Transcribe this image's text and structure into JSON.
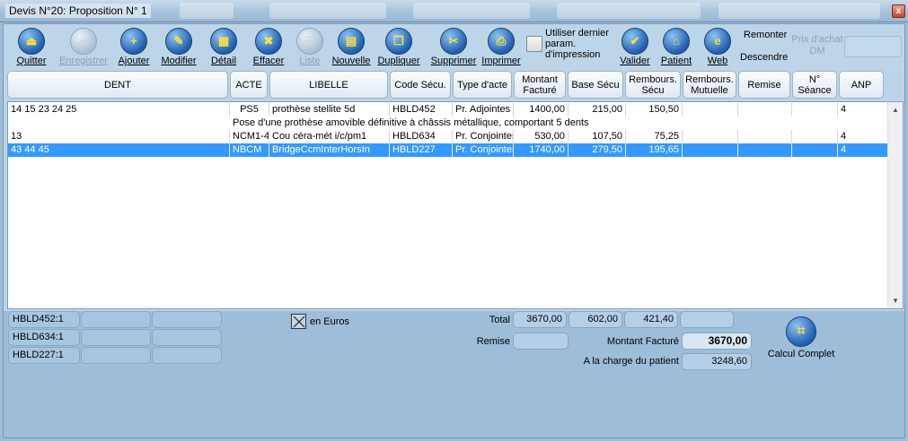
{
  "window": {
    "title": "Devis N°20: Proposition N° 1",
    "close": "x"
  },
  "toolbar": {
    "buttons": [
      {
        "label": "Quitter",
        "glyph": "⏏"
      },
      {
        "label": "Enregistrer",
        "glyph": "●"
      },
      {
        "label": "Ajouter",
        "glyph": "+"
      },
      {
        "label": "Modifier",
        "glyph": "✎"
      },
      {
        "label": "Détail",
        "glyph": "▦"
      },
      {
        "label": "Effacer",
        "glyph": "✖"
      },
      {
        "label": "Liste",
        "glyph": "☰"
      },
      {
        "label": "Nouvelle",
        "glyph": "▤"
      },
      {
        "label": "Dupliquer",
        "glyph": "❐"
      },
      {
        "label": "Supprimer",
        "glyph": "✂"
      },
      {
        "label": "Imprimer",
        "glyph": "⎙"
      }
    ],
    "use_last_params_label": "Utiliser dernier param. d'impression",
    "right_buttons": [
      {
        "label": "Valider",
        "glyph": "✔"
      },
      {
        "label": "Patient",
        "glyph": "⌂"
      },
      {
        "label": "Web",
        "glyph": "e"
      }
    ],
    "move_up": "Remonter",
    "move_down": "Descendre",
    "purchase_price_label": "Prix d'achat DM",
    "purchase_price_value": ""
  },
  "columns": [
    "DENT",
    "ACTE",
    "LIBELLE",
    "Code Sécu.",
    "Type d'acte",
    "Montant Facturé",
    "Base Sécu",
    "Rembours. Sécu",
    "Rembours. Mutuelle",
    "Remise",
    "N° Séance",
    "ANP"
  ],
  "rows": [
    {
      "dent": "14 15 23 24 25",
      "acte": "PS5",
      "libelle": "prothèse stellite 5d",
      "code": "HBLD452",
      "type": "Pr. Adjointes",
      "montant": "1400,00",
      "base": "215,00",
      "rembours_secu": "150,50",
      "rembours_mut": "",
      "remise": "",
      "seance": "",
      "anp": "4",
      "description": "Pose d'une prothèse amovible définitive à châssis métallique, comportant 5 dents",
      "selected": false
    },
    {
      "dent": "13",
      "acte": "NCM1-4",
      "libelle": "Cou céra-mét i/c/pm1",
      "code": "HBLD634",
      "type": "Pr. Conjointes",
      "montant": "530,00",
      "base": "107,50",
      "rembours_secu": "75,25",
      "rembours_mut": "",
      "remise": "",
      "seance": "",
      "anp": "4",
      "description": "",
      "selected": false
    },
    {
      "dent": "43 44 45",
      "acte": "NBCM",
      "libelle": "BridgeCcmInterHorsIn",
      "code": "HBLD227",
      "type": "Pr. Conjointes",
      "montant": "1740,00",
      "base": "279,50",
      "rembours_secu": "195,65",
      "rembours_mut": "",
      "remise": "",
      "seance": "",
      "anp": "4",
      "description": "",
      "selected": true
    }
  ],
  "footer": {
    "codes": [
      "HBLD452:1",
      "HBLD634:1",
      "HBLD227:1"
    ],
    "euro_label": "en Euros",
    "total_label": "Total",
    "total_montant": "3670,00",
    "total_base": "602,00",
    "total_rembours": "421,40",
    "total_mutuelle": "",
    "remise_label": "Remise",
    "remise_value": "",
    "montant_facture_label": "Montant Facturé",
    "montant_facture_value": "3670,00",
    "charge_patient_label": "A la charge du patient",
    "charge_patient_value": "3248,60",
    "calc_label": "Calcul Complet"
  },
  "colors": {
    "selection": "#3399ff",
    "background": "#9fbdd6",
    "icon_blue": "#1f5fae"
  },
  "icons": [
    "close-icon",
    "quit-icon",
    "save-icon",
    "add-icon",
    "edit-icon",
    "detail-icon",
    "erase-icon",
    "list-icon",
    "new-icon",
    "duplicate-icon",
    "delete-icon",
    "print-icon",
    "validate-icon",
    "patient-icon",
    "web-icon",
    "calculator-icon"
  ]
}
